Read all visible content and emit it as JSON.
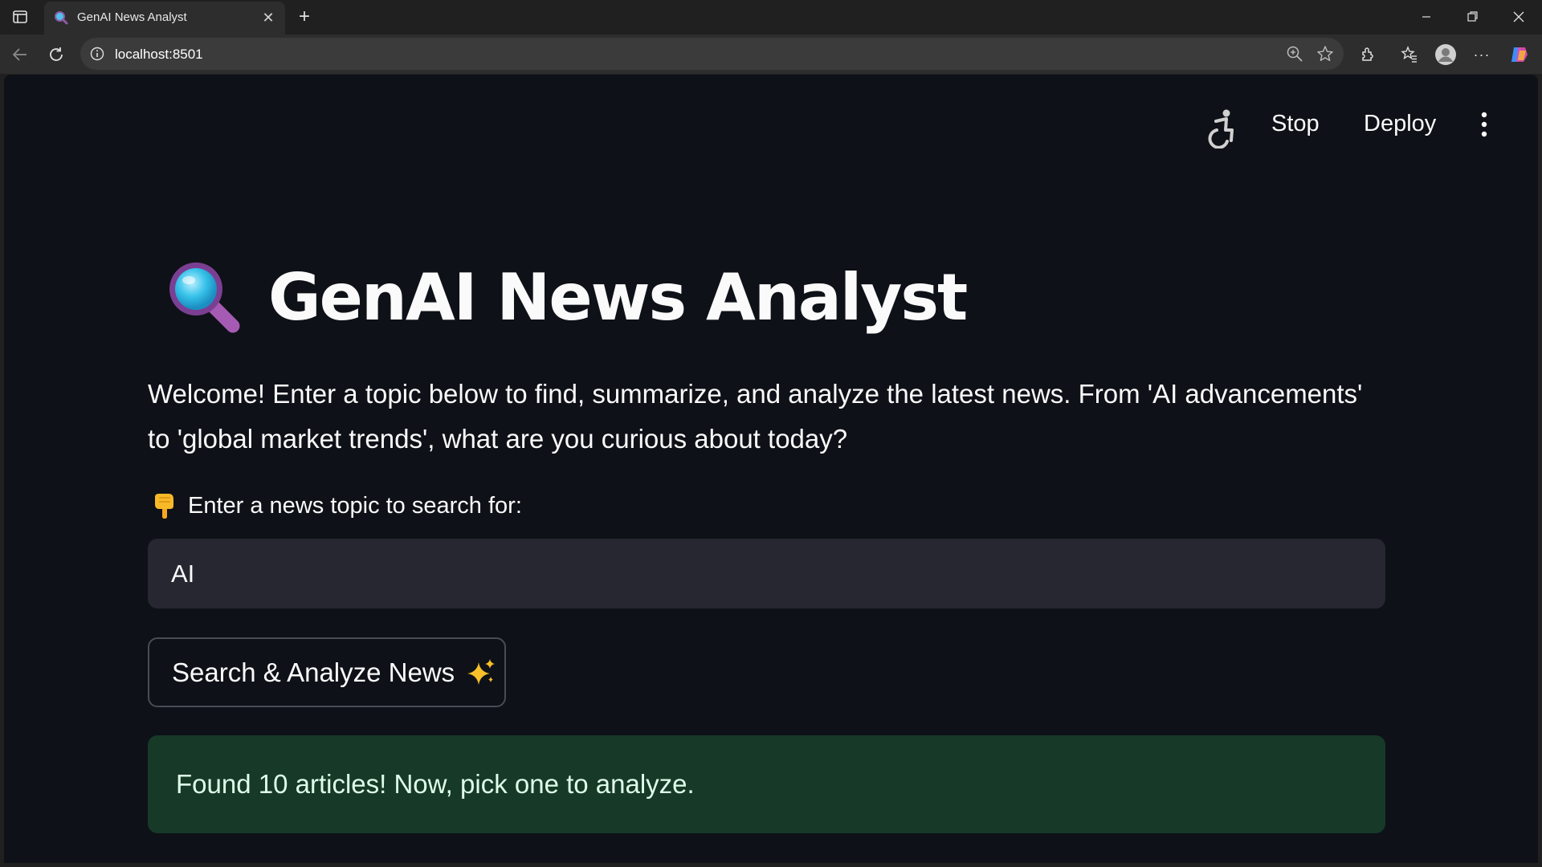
{
  "browser": {
    "tab_title": "GenAI News Analyst",
    "url": "localhost:8501",
    "new_tab_symbol": "+",
    "close_symbol": "✕"
  },
  "header": {
    "stop_label": "Stop",
    "deploy_label": "Deploy"
  },
  "main": {
    "title": "GenAI News Analyst",
    "welcome_text": "Welcome! Enter a topic below to find, summarize, and analyze the latest news. From 'AI advancements' to 'global market trends', what are you curious about today?",
    "input_label": "Enter a news topic to search for:",
    "input_value": "AI",
    "button_label": "Search & Analyze News",
    "success_message": "Found 10 articles! Now, pick one to analyze."
  },
  "icons": {
    "title": "magnifying-glass-icon",
    "input_label": "pointing-down-hand-icon",
    "button": "sparkles-icon"
  },
  "colors": {
    "app_background": "#0e1117",
    "input_background": "#262730",
    "success_background": "#173928",
    "success_text": "#dffde9",
    "text": "#fafafa"
  }
}
